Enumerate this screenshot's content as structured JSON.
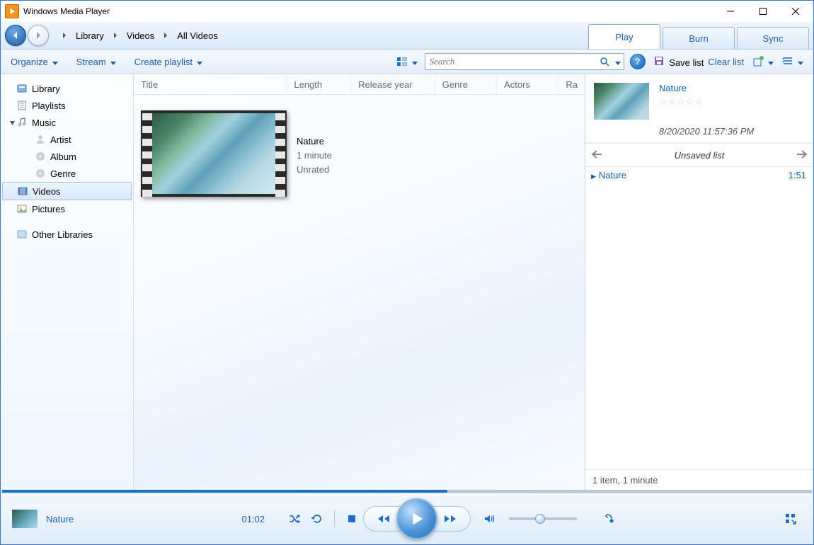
{
  "window": {
    "title": "Windows Media Player"
  },
  "breadcrumb": {
    "b1": "Library",
    "b2": "Videos",
    "b3": "All Videos"
  },
  "tabs": {
    "play": "Play",
    "burn": "Burn",
    "sync": "Sync"
  },
  "toolbar": {
    "organize": "Organize",
    "stream": "Stream",
    "create_playlist": "Create playlist"
  },
  "search": {
    "placeholder": "Search"
  },
  "list_actions": {
    "save": "Save list",
    "clear": "Clear list"
  },
  "sidebar": {
    "library": "Library",
    "playlists": "Playlists",
    "music": "Music",
    "artist": "Artist",
    "album": "Album",
    "genre": "Genre",
    "videos": "Videos",
    "pictures": "Pictures",
    "other": "Other Libraries"
  },
  "columns": {
    "title": "Title",
    "length": "Length",
    "release_year": "Release year",
    "genre": "Genre",
    "actors": "Actors",
    "rating": "Ra"
  },
  "video": {
    "title": "Nature",
    "length_text": "1 minute",
    "rating_text": "Unrated"
  },
  "right_pane": {
    "title": "Nature",
    "date": "8/20/2020 11:57:36 PM",
    "list_name": "Unsaved list",
    "item_title": "Nature",
    "item_len": "1:51",
    "footer": "1 item, 1 minute"
  },
  "player": {
    "now_playing": "Nature",
    "elapsed": "01:02",
    "seek_percent": 55,
    "volume_percent": 45
  }
}
